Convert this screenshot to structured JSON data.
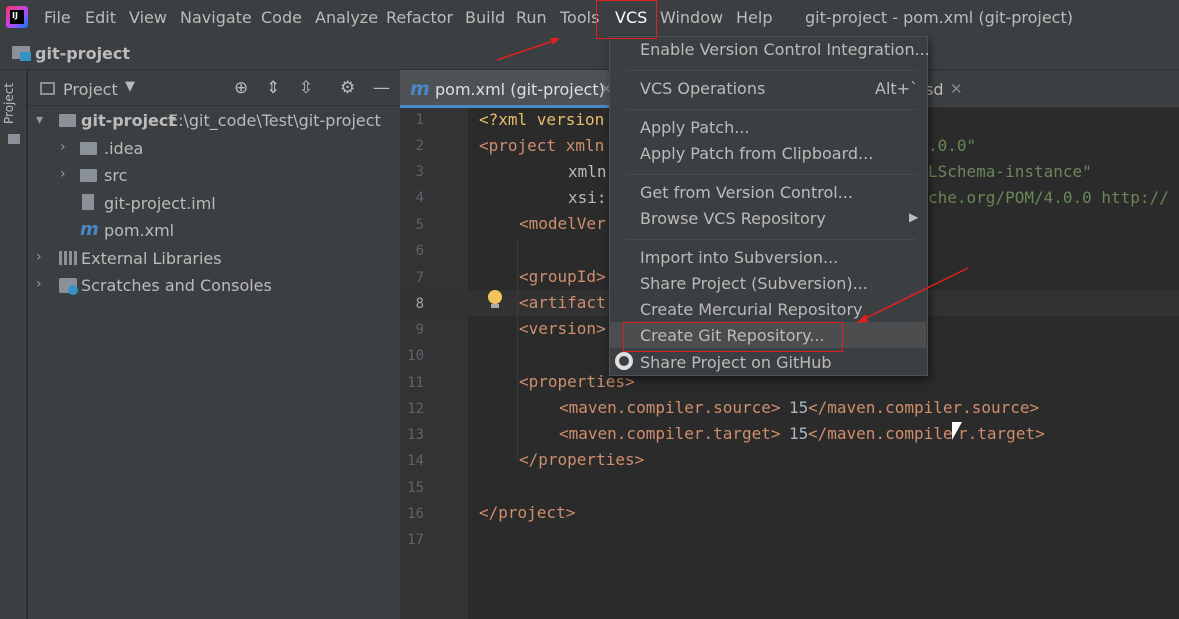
{
  "menu": [
    "File",
    "Edit",
    "View",
    "Navigate",
    "Code",
    "Analyze",
    "Refactor",
    "Build",
    "Run",
    "Tools",
    "VCS",
    "Window",
    "Help"
  ],
  "window_title": "git-project - pom.xml (git-project)",
  "nav_title": "git-project",
  "stripe_label": "Project",
  "project_panel": {
    "label": "Project",
    "root_name": "git-project",
    "root_path": "E:\\git_code\\Test\\git-project",
    "items": [
      ".idea",
      "src",
      "git-project.iml",
      "pom.xml",
      "External Libraries",
      "Scratches and Consoles"
    ]
  },
  "tabs": {
    "active": "pom.xml (git-project)",
    "second": "sd"
  },
  "line_numbers": [
    "1",
    "2",
    "3",
    "4",
    "5",
    "6",
    "7",
    "8",
    "9",
    "10",
    "11",
    "12",
    "13",
    "14",
    "15",
    "16",
    "17"
  ],
  "code": {
    "l1": "<?xml version",
    "l1b": ".0.0\"",
    "l2": "<project xmln",
    "l3": "xmln",
    "l3b": "LSchema-instance\"",
    "l4": "xsi:",
    "l4b": "che.org/POM/4.0.0 http://",
    "l5": "<modelVer",
    "l7": "<groupId>",
    "l8": "<artifact",
    "l9": "<version>",
    "l11": "<properties>",
    "l12a": "<maven.compiler.source>",
    "l12v": "15",
    "l12b": "</maven.compiler.source>",
    "l13a": "<maven.compiler.target>",
    "l13v": "15",
    "l13b": "</maven.compile",
    "l13c": "r.target>",
    "l14": "</properties>",
    "l16": "</project>"
  },
  "vcs_menu": {
    "enable": "Enable Version Control Integration...",
    "ops": "VCS Operations",
    "ops_shortcut": "Alt+`",
    "apply_patch": "Apply Patch...",
    "apply_clip": "Apply Patch from Clipboard...",
    "get_vc": "Get from Version Control...",
    "browse": "Browse VCS Repository",
    "import_svn": "Import into Subversion...",
    "share_svn": "Share Project (Subversion)...",
    "hg": "Create Mercurial Repository",
    "git": "Create Git Repository...",
    "github": "Share Project on GitHub"
  }
}
